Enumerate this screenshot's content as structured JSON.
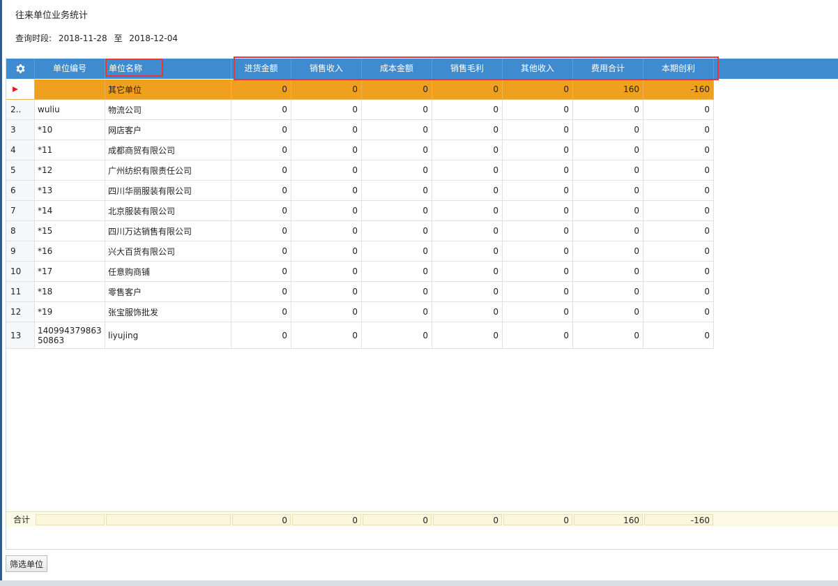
{
  "page": {
    "title": "往来单位业务统计",
    "period_label": "查询时段:",
    "date_from": "2018-11-28",
    "date_sep": "至",
    "date_to": "2018-12-04"
  },
  "columns": {
    "code": "单位编号",
    "name": "单位名称",
    "purchase": "进货金额",
    "sales": "销售收入",
    "cost": "成本金额",
    "gross": "销售毛利",
    "other_income": "其他收入",
    "expense": "费用合计",
    "profit": "本期创利"
  },
  "rows": [
    {
      "idx": "",
      "code": "",
      "name": "其它单位",
      "purchase": "0",
      "sales": "0",
      "cost": "0",
      "gross": "0",
      "other_income": "0",
      "expense": "160",
      "profit": "-160"
    },
    {
      "idx": "2..",
      "code": "wuliu",
      "name": "物流公司",
      "purchase": "0",
      "sales": "0",
      "cost": "0",
      "gross": "0",
      "other_income": "0",
      "expense": "0",
      "profit": "0"
    },
    {
      "idx": "3",
      "code": "*10",
      "name": "网店客户",
      "purchase": "0",
      "sales": "0",
      "cost": "0",
      "gross": "0",
      "other_income": "0",
      "expense": "0",
      "profit": "0"
    },
    {
      "idx": "4",
      "code": "*11",
      "name": "成都商贸有限公司",
      "purchase": "0",
      "sales": "0",
      "cost": "0",
      "gross": "0",
      "other_income": "0",
      "expense": "0",
      "profit": "0"
    },
    {
      "idx": "5",
      "code": "*12",
      "name": "广州纺织有限责任公司",
      "purchase": "0",
      "sales": "0",
      "cost": "0",
      "gross": "0",
      "other_income": "0",
      "expense": "0",
      "profit": "0"
    },
    {
      "idx": "6",
      "code": "*13",
      "name": "四川华丽服装有限公司",
      "purchase": "0",
      "sales": "0",
      "cost": "0",
      "gross": "0",
      "other_income": "0",
      "expense": "0",
      "profit": "0"
    },
    {
      "idx": "7",
      "code": "*14",
      "name": "北京服装有限公司",
      "purchase": "0",
      "sales": "0",
      "cost": "0",
      "gross": "0",
      "other_income": "0",
      "expense": "0",
      "profit": "0"
    },
    {
      "idx": "8",
      "code": "*15",
      "name": "四川万达销售有限公司",
      "purchase": "0",
      "sales": "0",
      "cost": "0",
      "gross": "0",
      "other_income": "0",
      "expense": "0",
      "profit": "0"
    },
    {
      "idx": "9",
      "code": "*16",
      "name": "兴大百货有限公司",
      "purchase": "0",
      "sales": "0",
      "cost": "0",
      "gross": "0",
      "other_income": "0",
      "expense": "0",
      "profit": "0"
    },
    {
      "idx": "10",
      "code": "*17",
      "name": "任意购商铺",
      "purchase": "0",
      "sales": "0",
      "cost": "0",
      "gross": "0",
      "other_income": "0",
      "expense": "0",
      "profit": "0"
    },
    {
      "idx": "11",
      "code": "*18",
      "name": "零售客户",
      "purchase": "0",
      "sales": "0",
      "cost": "0",
      "gross": "0",
      "other_income": "0",
      "expense": "0",
      "profit": "0"
    },
    {
      "idx": "12",
      "code": "*19",
      "name": "张宝服饰批发",
      "purchase": "0",
      "sales": "0",
      "cost": "0",
      "gross": "0",
      "other_income": "0",
      "expense": "0",
      "profit": "0"
    },
    {
      "idx": "13",
      "code": "14099437986350863",
      "name": "liyujing",
      "purchase": "0",
      "sales": "0",
      "cost": "0",
      "gross": "0",
      "other_income": "0",
      "expense": "0",
      "profit": "0"
    }
  ],
  "totals": {
    "label": "合计",
    "purchase": "0",
    "sales": "0",
    "cost": "0",
    "gross": "0",
    "other_income": "0",
    "expense": "160",
    "profit": "-160"
  },
  "actions": {
    "filter_label": "筛选单位"
  },
  "colors": {
    "header_blue": "#3f8bd0",
    "selected_row": "#f0a01f",
    "highlight_red": "#e53935"
  },
  "icons": {
    "settings": "gear-icon",
    "current_row": "current-row-arrow-icon"
  }
}
